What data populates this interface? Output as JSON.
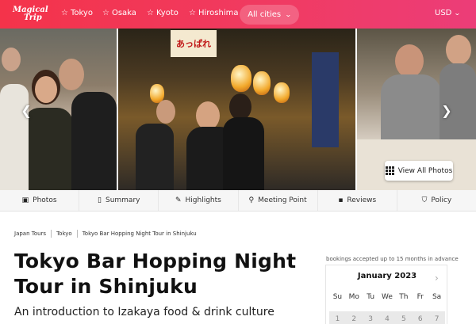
{
  "nav": {
    "logo_line1": "Magical",
    "logo_line2": "Trip",
    "cities": [
      {
        "label": "Tokyo"
      },
      {
        "label": "Osaka"
      },
      {
        "label": "Kyoto"
      },
      {
        "label": "Hiroshima"
      }
    ],
    "all_cities_label": "All cities",
    "currency": "USD",
    "star_icon": "star-icon",
    "brand_color": "#f03b63"
  },
  "gallery": {
    "view_all_label": "View All Photos",
    "sign_text": "あっぱれ"
  },
  "tabs": [
    {
      "label": "Photos",
      "icon": "photos-icon"
    },
    {
      "label": "Summary",
      "icon": "document-icon"
    },
    {
      "label": "Highlights",
      "icon": "pen-icon"
    },
    {
      "label": "Meeting Point",
      "icon": "pin-icon"
    },
    {
      "label": "Reviews",
      "icon": "chat-icon"
    },
    {
      "label": "Policy",
      "icon": "shield-icon"
    }
  ],
  "breadcrumb": [
    "Japan Tours",
    "Tokyo",
    "Tokyo Bar Hopping Night Tour in Shinjuku"
  ],
  "tour": {
    "title": "Tokyo Bar Hopping Night Tour in Shinjuku",
    "subtitle": "An introduction to Izakaya food & drink culture"
  },
  "booking": {
    "note": "bookings accepted up to 15 months in advance",
    "month": "January 2023",
    "weekdays": [
      "Su",
      "Mo",
      "Tu",
      "We",
      "Th",
      "Fr",
      "Sa"
    ],
    "dates": [
      "1",
      "2",
      "3",
      "4",
      "5",
      "6",
      "7"
    ]
  }
}
